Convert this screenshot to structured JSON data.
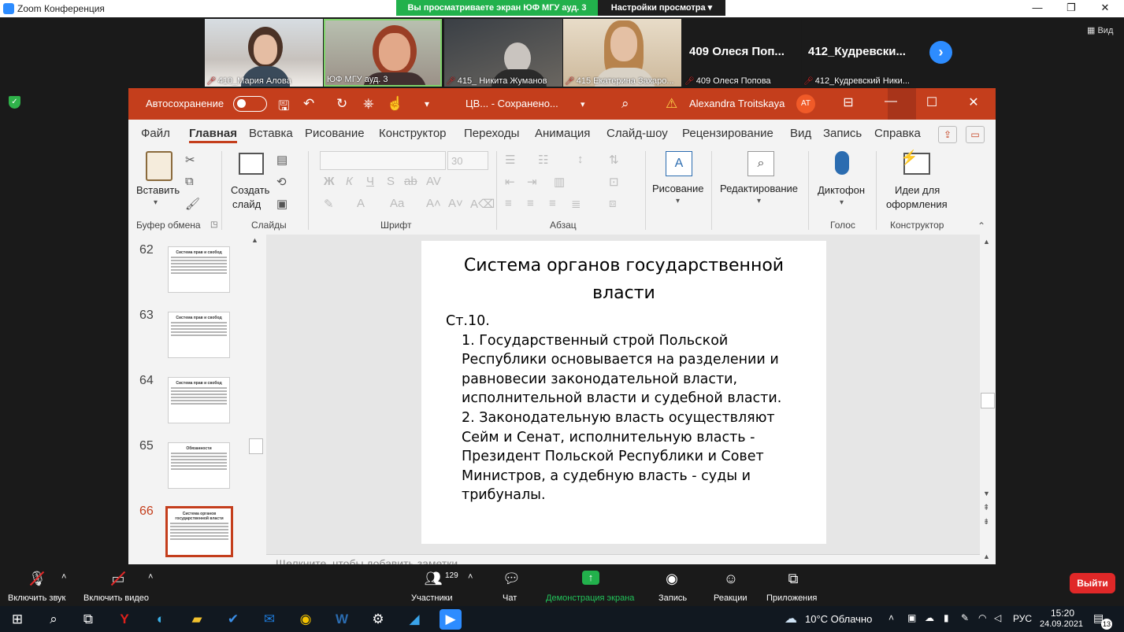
{
  "zoom_window": {
    "title": "Zoom Конференция"
  },
  "share_banner": {
    "text": "Вы просматриваете экран ЮФ МГУ ауд. 3",
    "options": "Настройки просмотра"
  },
  "participants": [
    {
      "name": "410_Мария Алова",
      "muted": true
    },
    {
      "name": "ЮФ МГУ ауд. 3",
      "muted": false
    },
    {
      "name": "415_ Никита Жуманов",
      "muted": true
    },
    {
      "name": "415 Екатерина Захаро...",
      "muted": true
    },
    {
      "name": "409 Олеся Попова",
      "big": "409 Олеся Поп...",
      "muted": true
    },
    {
      "name": "412_Кудревский Ники...",
      "big": "412_Кудревски...",
      "muted": true
    }
  ],
  "view_button": "Вид",
  "ppt": {
    "autosave": "Автосохранение",
    "doc_name": "ЦВ... - Сохранено...",
    "user": "Alexandra Troitskaya",
    "avatar_initials": "AT",
    "menu": [
      "Файл",
      "Главная",
      "Вставка",
      "Рисование",
      "Конструктор",
      "Переходы",
      "Анимация",
      "Слайд-шоу",
      "Рецензирование",
      "Вид",
      "Запись",
      "Справка"
    ],
    "ribbon": {
      "paste": "Вставить",
      "new_slide_1": "Создать",
      "new_slide_2": "слайд",
      "font_size": "30",
      "drawing": "Рисование",
      "editing": "Редактирование",
      "dictate": "Диктофон",
      "ideas_1": "Идеи для",
      "ideas_2": "оформления",
      "groups": {
        "clipboard": "Буфер обмена",
        "slides": "Слайды",
        "font": "Шрифт",
        "paragraph": "Абзац",
        "voice": "Голос",
        "designer": "Конструктор"
      }
    },
    "thumbnails": [
      {
        "num": "62",
        "title": "Система прав и свобод"
      },
      {
        "num": "63",
        "title": "Система прав и свобод"
      },
      {
        "num": "64",
        "title": "Система прав и свобод"
      },
      {
        "num": "65",
        "title": "Обязанности"
      },
      {
        "num": "66",
        "title": "Система органов государственной власти"
      }
    ],
    "slide": {
      "title_1": "Система органов государственной",
      "title_2": "власти",
      "article": "Ст.10.",
      "p1_lines": [
        "1. Государственный строй Польской",
        "Республики основывается на разделении и",
        "равновесии законодательной власти,",
        "исполнительной власти и судебной власти."
      ],
      "p2_lines": [
        "2. Законодательную власть осуществляют",
        "Сейм и Сенат, исполнительную власть -",
        "Президент Польской Республики и Совет",
        "Министров, а судебную власть - суды и",
        "трибуналы."
      ]
    },
    "notes_placeholder": "Щелкните, чтобы добавить заметки"
  },
  "zoom_toolbar": {
    "audio": "Включить звук",
    "video": "Включить видео",
    "participants": "Участники",
    "participants_count": "129",
    "chat": "Чат",
    "share": "Демонстрация экрана",
    "record": "Запись",
    "reactions": "Реакции",
    "apps": "Приложения",
    "exit": "Выйти"
  },
  "taskbar": {
    "weather": "10°C Облачно",
    "lang": "РУС",
    "time": "15:20",
    "date": "24.09.2021",
    "notifications": "13"
  }
}
